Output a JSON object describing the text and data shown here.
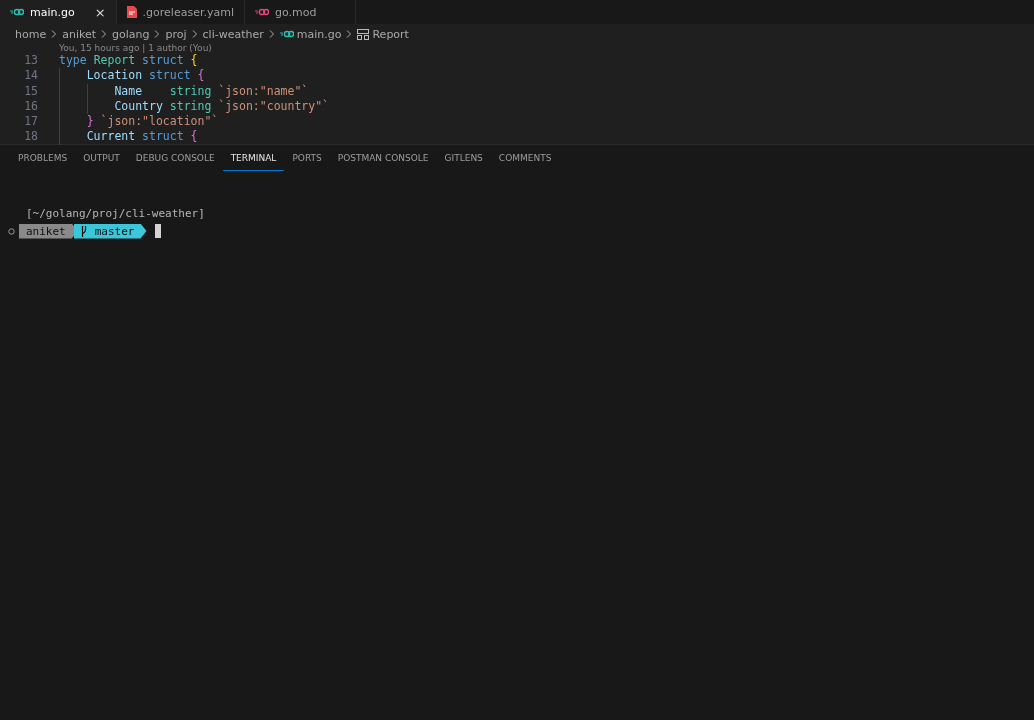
{
  "editor_tabs": [
    {
      "label": "main.go",
      "kind": "go",
      "selected": true,
      "close": "×"
    },
    {
      "label": ".goreleaser.yaml",
      "kind": "yaml",
      "selected": false
    },
    {
      "label": "go.mod",
      "kind": "gomod",
      "selected": false
    }
  ],
  "breadcrumbs": [
    {
      "label": "home",
      "kind": "folder"
    },
    {
      "label": "aniket",
      "kind": "folder"
    },
    {
      "label": "golang",
      "kind": "folder"
    },
    {
      "label": "proj",
      "kind": "folder"
    },
    {
      "label": "cli-weather",
      "kind": "folder"
    },
    {
      "label": "main.go",
      "kind": "go"
    },
    {
      "label": "Report",
      "kind": "struct"
    }
  ],
  "codelens": "You, 15 hours ago | 1 author (You)",
  "code_lines": [
    {
      "number": "13",
      "tokens": [
        {
          "text": "type ",
          "kind": "keyword"
        },
        {
          "text": "Report ",
          "kind": "type"
        },
        {
          "text": "struct ",
          "kind": "keyword"
        },
        {
          "text": "{",
          "kind": "brace1"
        }
      ]
    },
    {
      "number": "14",
      "tokens": [
        {
          "text": "    Location ",
          "kind": "field"
        },
        {
          "text": "struct ",
          "kind": "keyword"
        },
        {
          "text": "{",
          "kind": "brace2"
        }
      ]
    },
    {
      "number": "15",
      "tokens": [
        {
          "text": "        Name    ",
          "kind": "field"
        },
        {
          "text": "string ",
          "kind": "type"
        },
        {
          "text": "`json:\"name\"`",
          "kind": "string"
        }
      ]
    },
    {
      "number": "16",
      "tokens": [
        {
          "text": "        Country ",
          "kind": "field"
        },
        {
          "text": "string ",
          "kind": "type"
        },
        {
          "text": "`json:\"country\"`",
          "kind": "string"
        }
      ]
    },
    {
      "number": "17",
      "tokens": [
        {
          "text": "    } ",
          "kind": "brace2"
        },
        {
          "text": "`json:\"location\"`",
          "kind": "string"
        }
      ]
    },
    {
      "number": "18",
      "tokens": [
        {
          "text": "    Current ",
          "kind": "field"
        },
        {
          "text": "struct ",
          "kind": "keyword"
        },
        {
          "text": "{",
          "kind": "brace2"
        }
      ]
    }
  ],
  "panel_tabs": [
    {
      "label": "PROBLEMS",
      "selected": false
    },
    {
      "label": "OUTPUT",
      "selected": false
    },
    {
      "label": "DEBUG CONSOLE",
      "selected": false
    },
    {
      "label": "TERMINAL",
      "selected": true
    },
    {
      "label": "PORTS",
      "selected": false
    },
    {
      "label": "POSTMAN CONSOLE",
      "selected": false
    },
    {
      "label": "GITLENS",
      "selected": false
    },
    {
      "label": "COMMENTS",
      "selected": false
    }
  ],
  "terminal": {
    "path": "[~/golang/proj/cli-weather]",
    "user": "aniket",
    "branch": "master"
  }
}
